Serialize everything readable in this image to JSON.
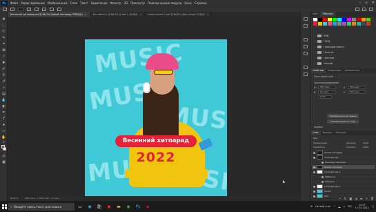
{
  "menu": {
    "items": [
      "Файл",
      "Редактирование",
      "Изображение",
      "Слои",
      "Текст",
      "Выделение",
      "Фильтр",
      "3D",
      "Просмотр",
      "Подключаемые модули",
      "Окно",
      "Справка"
    ]
  },
  "tabs": [
    {
      "label": "Весенний хитпарад.psd @ 66,7% (Новый хитпарад, RGB/8#)",
      "active": true
    },
    {
      "label": "Без имени-1 @ 66,7% (Слой 1, RGB/8)",
      "active": false
    },
    {
      "label": "новые песни 1.psd @ 66,6% (Фон копия, RGB/8)",
      "active": false
    }
  ],
  "artwork": {
    "bg_word": "MUSIC",
    "banner": "Весенний хитпарад",
    "year": "2022",
    "colors": {
      "bg": "#3fc9d6",
      "banner": "#e62237",
      "yellow": "#f1c40f",
      "hat": "#ea4c89"
    }
  },
  "status": {
    "zoom": "66,67%",
    "doc": "1080 пикс. x 1080 пикс. (72 ppi)"
  },
  "swatches_panel": {
    "tabs": [
      "Цвет",
      "Образцы"
    ],
    "colors": [
      "#ffffff",
      "#000000",
      "#ff0000",
      "#ffff00",
      "#00ff00",
      "#00ffff",
      "#0000ff",
      "#ff00ff",
      "#888888",
      "#cc0000",
      "#ff9900",
      "#66cc00",
      "#e62237",
      "#f1c40f",
      "#3fc9d6",
      "#ea4c89",
      "#3498db",
      "#7f8c8d",
      "#9b59b6",
      "#2ecc71",
      "#e67e22",
      "#1abc9c",
      "#34495e",
      "#c0392b"
    ],
    "groups": [
      "RGB",
      "CMYK",
      "Градации серого",
      "Пастель",
      "Светлый",
      "Чистый"
    ]
  },
  "properties_panel": {
    "tabs": [
      "Свойства",
      "Коррекция",
      "Библиотеки"
    ],
    "title": "Текстовый слой",
    "section": "Трансформирование",
    "w_label": "Ш",
    "w_value": "552 пикс.",
    "h_label": "В",
    "h_value": "90 пикс.",
    "x_label": "X",
    "x_value": "264 пикс.",
    "y_label": "Y",
    "y_value": "550 пикс.",
    "angle": "0,00°",
    "convert_btn": "Преобразовать в кривые",
    "params_btn": "Преобразовать в слой",
    "section2": "Символ"
  },
  "layers_panel": {
    "tabs": [
      "Слои",
      "Каналы",
      "Контуры"
    ],
    "kind": "Вид",
    "blend": "Нормальный",
    "opacity_label": "Непрозр.:",
    "opacity": "100%",
    "fill_label": "Заливка:",
    "fill": "100%",
    "lock_label": "Закрепить:",
    "rows": [
      {
        "name": "Новый хитпарад",
        "thumb": "dark",
        "sel": false
      },
      {
        "name": "Слой-фигура",
        "thumb": "dark",
        "sel": false
      },
      {
        "name": "Внешнее свечение",
        "thumb": "none",
        "sel": false
      },
      {
        "name": "Новый хитпарад",
        "thumb": "dark",
        "sel": true
      },
      {
        "name": "Слой-фигура 1",
        "thumb": "white",
        "sel": false
      },
      {
        "name": "Эффекты",
        "thumb": "none",
        "sel": false
      },
      {
        "name": "Обводка",
        "thumb": "none",
        "sel": false
      },
      {
        "name": "Слой-фигура 2",
        "thumb": "white",
        "sel": false
      },
      {
        "name": "Слой 1",
        "thumb": "cyan",
        "sel": false
      },
      {
        "name": "Фон",
        "thumb": "cyan",
        "sel": false
      }
    ]
  },
  "taskbar": {
    "search_placeholder": "Введите здесь текст для поиска",
    "weather": "Легкий снег",
    "lang": "РУС",
    "time": "12:57",
    "date": "17.01.2022"
  }
}
